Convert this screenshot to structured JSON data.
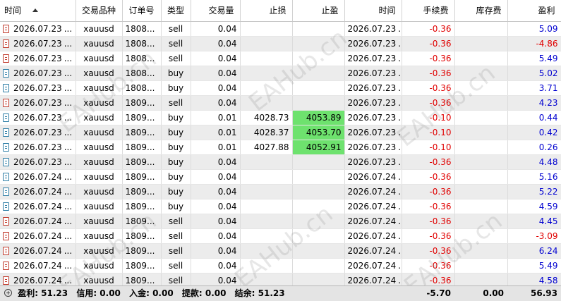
{
  "columns": {
    "time": "时间",
    "symbol": "交易品种",
    "ticket": "订单号",
    "type": "类型",
    "volume": "交易量",
    "sl": "止损",
    "tp": "止盈",
    "close_time": "时间",
    "commission": "手续费",
    "swap": "库存费",
    "profit": "盈利"
  },
  "rows": [
    {
      "time": "2026.07.23",
      "symbol": "xauusd",
      "ticket": "1808...",
      "type": "sell",
      "volume": "0.04",
      "sl": "",
      "tp": "",
      "close_time": "2026.07.23",
      "commission": "-0.36",
      "swap": "",
      "profit": "5.09"
    },
    {
      "time": "2026.07.23",
      "symbol": "xauusd",
      "ticket": "1808...",
      "type": "sell",
      "volume": "0.04",
      "sl": "",
      "tp": "",
      "close_time": "2026.07.23",
      "commission": "-0.36",
      "swap": "",
      "profit": "-4.86"
    },
    {
      "time": "2026.07.23",
      "symbol": "xauusd",
      "ticket": "1808...",
      "type": "sell",
      "volume": "0.04",
      "sl": "",
      "tp": "",
      "close_time": "2026.07.23",
      "commission": "-0.36",
      "swap": "",
      "profit": "5.49"
    },
    {
      "time": "2026.07.23",
      "symbol": "xauusd",
      "ticket": "1808...",
      "type": "buy",
      "volume": "0.04",
      "sl": "",
      "tp": "",
      "close_time": "2026.07.23",
      "commission": "-0.36",
      "swap": "",
      "profit": "5.02"
    },
    {
      "time": "2026.07.23",
      "symbol": "xauusd",
      "ticket": "1808...",
      "type": "buy",
      "volume": "0.04",
      "sl": "",
      "tp": "",
      "close_time": "2026.07.23",
      "commission": "-0.36",
      "swap": "",
      "profit": "3.71"
    },
    {
      "time": "2026.07.23",
      "symbol": "xauusd",
      "ticket": "1809...",
      "type": "sell",
      "volume": "0.04",
      "sl": "",
      "tp": "",
      "close_time": "2026.07.23",
      "commission": "-0.36",
      "swap": "",
      "profit": "4.23"
    },
    {
      "time": "2026.07.23",
      "symbol": "xauusd",
      "ticket": "1809...",
      "type": "buy",
      "volume": "0.01",
      "sl": "4028.73",
      "tp": "4053.89",
      "close_time": "2026.07.23",
      "commission": "-0.10",
      "swap": "",
      "profit": "0.44"
    },
    {
      "time": "2026.07.23",
      "symbol": "xauusd",
      "ticket": "1809...",
      "type": "buy",
      "volume": "0.01",
      "sl": "4028.37",
      "tp": "4053.70",
      "close_time": "2026.07.23",
      "commission": "-0.10",
      "swap": "",
      "profit": "0.42"
    },
    {
      "time": "2026.07.23",
      "symbol": "xauusd",
      "ticket": "1809...",
      "type": "buy",
      "volume": "0.01",
      "sl": "4027.88",
      "tp": "4052.91",
      "close_time": "2026.07.23",
      "commission": "-0.10",
      "swap": "",
      "profit": "0.26"
    },
    {
      "time": "2026.07.23",
      "symbol": "xauusd",
      "ticket": "1809...",
      "type": "buy",
      "volume": "0.04",
      "sl": "",
      "tp": "",
      "close_time": "2026.07.23",
      "commission": "-0.36",
      "swap": "",
      "profit": "4.48"
    },
    {
      "time": "2026.07.24",
      "symbol": "xauusd",
      "ticket": "1809...",
      "type": "buy",
      "volume": "0.04",
      "sl": "",
      "tp": "",
      "close_time": "2026.07.24",
      "commission": "-0.36",
      "swap": "",
      "profit": "5.16"
    },
    {
      "time": "2026.07.24",
      "symbol": "xauusd",
      "ticket": "1809...",
      "type": "buy",
      "volume": "0.04",
      "sl": "",
      "tp": "",
      "close_time": "2026.07.24",
      "commission": "-0.36",
      "swap": "",
      "profit": "5.22"
    },
    {
      "time": "2026.07.24",
      "symbol": "xauusd",
      "ticket": "1809...",
      "type": "buy",
      "volume": "0.04",
      "sl": "",
      "tp": "",
      "close_time": "2026.07.24",
      "commission": "-0.36",
      "swap": "",
      "profit": "4.59"
    },
    {
      "time": "2026.07.24",
      "symbol": "xauusd",
      "ticket": "1809...",
      "type": "sell",
      "volume": "0.04",
      "sl": "",
      "tp": "",
      "close_time": "2026.07.24",
      "commission": "-0.36",
      "swap": "",
      "profit": "4.45"
    },
    {
      "time": "2026.07.24",
      "symbol": "xauusd",
      "ticket": "1809...",
      "type": "sell",
      "volume": "0.04",
      "sl": "",
      "tp": "",
      "close_time": "2026.07.24",
      "commission": "-0.36",
      "swap": "",
      "profit": "-3.09"
    },
    {
      "time": "2026.07.24",
      "symbol": "xauusd",
      "ticket": "1809...",
      "type": "sell",
      "volume": "0.04",
      "sl": "",
      "tp": "",
      "close_time": "2026.07.24",
      "commission": "-0.36",
      "swap": "",
      "profit": "6.24"
    },
    {
      "time": "2026.07.24",
      "symbol": "xauusd",
      "ticket": "1809...",
      "type": "sell",
      "volume": "0.04",
      "sl": "",
      "tp": "",
      "close_time": "2026.07.24",
      "commission": "-0.36",
      "swap": "",
      "profit": "5.49"
    },
    {
      "time": "2026.07.24",
      "symbol": "xauusd",
      "ticket": "1809...",
      "type": "sell",
      "volume": "0.04",
      "sl": "",
      "tp": "",
      "close_time": "2026.07.24",
      "commission": "-0.36",
      "swap": "",
      "profit": "4.58"
    }
  ],
  "footer": {
    "profit_label": "盈利: 51.23",
    "credit_label": "信用: 0.00",
    "deposit_label": "入金: 0.00",
    "withdrawal_label": "提款: 0.00",
    "balance_label": "结余: 51.23",
    "commission_total": "-5.70",
    "swap_total": "0.00",
    "profit_total": "56.93"
  },
  "watermark": "EAHub.cn",
  "colors": {
    "tp_highlight": "#6ee26e",
    "negative": "#e00000",
    "positive": "#0000d0",
    "sell_icon": "#c0392b",
    "buy_icon": "#2e7ea6"
  }
}
